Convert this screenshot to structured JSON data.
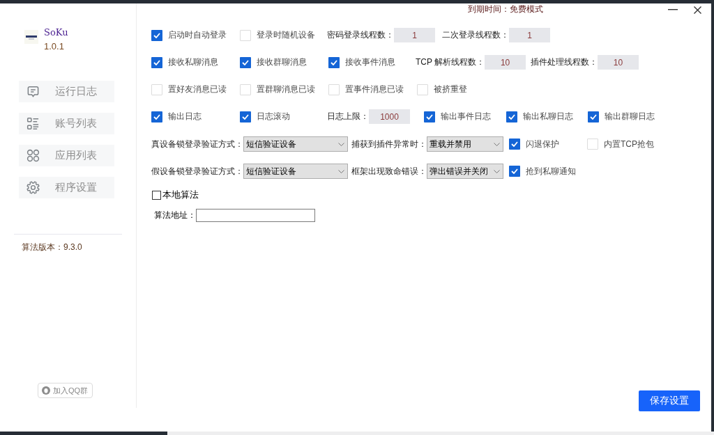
{
  "window": {
    "expiry": "到期时间：免费模式"
  },
  "sidebar": {
    "app_name": "SoKu",
    "version": "1.0.1",
    "nav": [
      {
        "label": "运行日志",
        "selected": false
      },
      {
        "label": "账号列表",
        "selected": false
      },
      {
        "label": "应用列表",
        "selected": false
      },
      {
        "label": "程序设置",
        "selected": false
      }
    ],
    "algorithm_version": "算法版本：9.3.0",
    "qq_group_button": "加入QQ群"
  },
  "settings": {
    "rows": [
      {
        "items": [
          {
            "kind": "checkbox",
            "label": "启动时自动登录",
            "checked": true
          },
          {
            "kind": "checkbox",
            "label": "登录时随机设备",
            "checked": false
          },
          {
            "kind": "number",
            "label": "密码登录线程数：",
            "value": "1"
          },
          {
            "kind": "number",
            "label": "二次登录线程数：",
            "value": "1"
          }
        ]
      },
      {
        "items": [
          {
            "kind": "checkbox",
            "label": "接收私聊消息",
            "checked": true
          },
          {
            "kind": "checkbox",
            "label": "接收群聊消息",
            "checked": true
          },
          {
            "kind": "checkbox",
            "label": "接收事件消息",
            "checked": true
          },
          {
            "kind": "number",
            "label": "TCP 解析线程数：",
            "value": "10"
          },
          {
            "kind": "number",
            "label": "插件处理线程数：",
            "value": "10"
          }
        ]
      },
      {
        "items": [
          {
            "kind": "checkbox",
            "label": "置好友消息已读",
            "checked": false
          },
          {
            "kind": "checkbox",
            "label": "置群聊消息已读",
            "checked": false
          },
          {
            "kind": "checkbox",
            "label": "置事件消息已读",
            "checked": false
          },
          {
            "kind": "checkbox",
            "label": "被挤重登",
            "checked": false
          }
        ]
      },
      {
        "items": [
          {
            "kind": "checkbox",
            "label": "输出日志",
            "checked": true
          },
          {
            "kind": "checkbox",
            "label": "日志滚动",
            "checked": true
          },
          {
            "kind": "number",
            "label": "日志上限：",
            "value": "1000"
          },
          {
            "kind": "checkbox",
            "label": "输出事件日志",
            "checked": true
          },
          {
            "kind": "checkbox",
            "label": "输出私聊日志",
            "checked": true
          },
          {
            "kind": "checkbox",
            "label": "输出群聊日志",
            "checked": true
          }
        ]
      },
      {
        "items": [
          {
            "kind": "select",
            "label": "真设备锁登录验证方式：",
            "value": "短信验证设备"
          },
          {
            "kind": "select",
            "label": "捕获到插件异常时：",
            "value": "重载并禁用"
          },
          {
            "kind": "checkbox",
            "label": "闪退保护",
            "checked": true
          },
          {
            "kind": "checkbox",
            "label": "内置TCP抢包",
            "checked": false
          }
        ]
      },
      {
        "items": [
          {
            "kind": "select",
            "label": "假设备锁登录验证方式：",
            "value": "短信验证设备"
          },
          {
            "kind": "select",
            "label": "框架出现致命错误：",
            "value": "弹出错误并关闭"
          },
          {
            "kind": "checkbox",
            "label": "抢到私聊通知",
            "checked": true
          }
        ]
      },
      {
        "items": [
          {
            "kind": "plain_checkbox",
            "label": "本地算法",
            "checked": false
          }
        ]
      },
      {
        "items": [
          {
            "kind": "text",
            "label": "算法地址："
          }
        ]
      }
    ]
  },
  "save_button": "保存设置"
}
